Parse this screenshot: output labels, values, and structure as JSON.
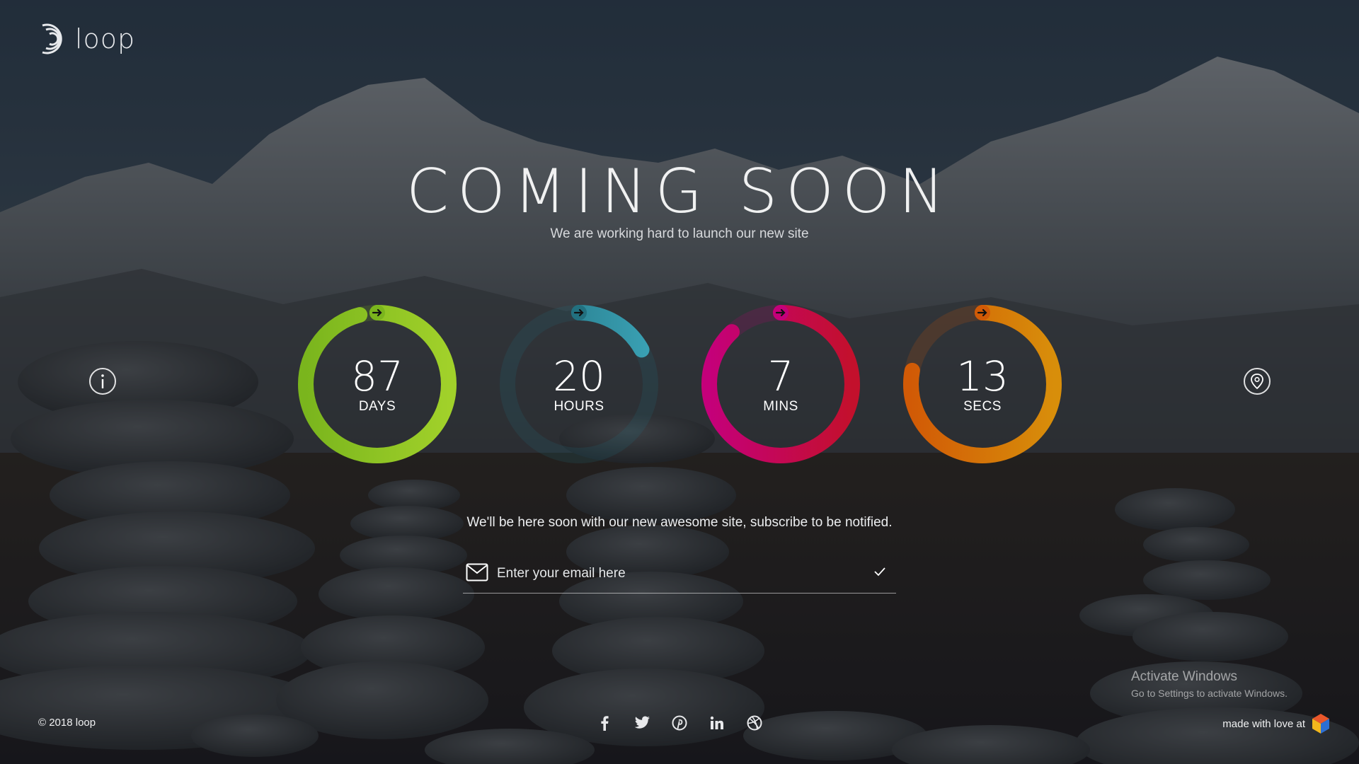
{
  "brand": {
    "name": "loop"
  },
  "hero": {
    "title": "COMING SOON",
    "subtitle": "We are working hard to launch our new site"
  },
  "countdown": [
    {
      "value": "87",
      "label": "DAYS",
      "progress": 0.96,
      "colors": [
        "#7ab51d",
        "#a1d12a"
      ]
    },
    {
      "value": "20",
      "label": "HOURS",
      "progress": 0.17,
      "colors": [
        "#22707f",
        "#3aa1b4"
      ]
    },
    {
      "value": "7",
      "label": "MINS",
      "progress": 0.88,
      "colors": [
        "#c4007a",
        "#c3102c"
      ]
    },
    {
      "value": "13",
      "label": "SECS",
      "progress": 0.78,
      "colors": [
        "#d15a06",
        "#d88e0a"
      ]
    }
  ],
  "subscribe": {
    "message": "We'll be here soon with our new awesome site, subscribe to be notified.",
    "placeholder": "Enter your email here"
  },
  "footer": {
    "copyright": "© 2018 loop",
    "made_with": "made with love at",
    "social": [
      "facebook-icon",
      "twitter-icon",
      "pinterest-icon",
      "linkedin-icon",
      "dribbble-icon"
    ]
  },
  "watermark": {
    "title": "Activate Windows",
    "subtitle": "Go to Settings to activate Windows."
  }
}
